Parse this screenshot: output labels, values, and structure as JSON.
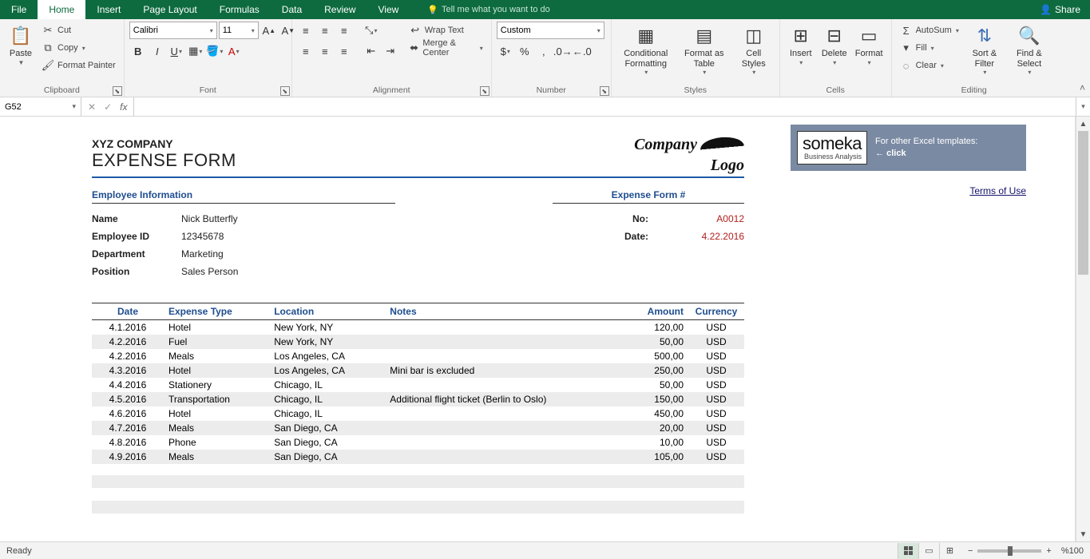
{
  "menu": {
    "tabs": [
      "File",
      "Home",
      "Insert",
      "Page Layout",
      "Formulas",
      "Data",
      "Review",
      "View"
    ],
    "active": "Home",
    "tell_me": "Tell me what you want to do",
    "share": "Share"
  },
  "ribbon": {
    "clipboard": {
      "label": "Clipboard",
      "paste": "Paste",
      "cut": "Cut",
      "copy": "Copy",
      "format_painter": "Format Painter"
    },
    "font": {
      "label": "Font",
      "name": "Calibri",
      "size": "11"
    },
    "alignment": {
      "label": "Alignment",
      "wrap": "Wrap Text",
      "merge": "Merge & Center"
    },
    "number": {
      "label": "Number",
      "format": "Custom"
    },
    "styles": {
      "label": "Styles",
      "cond": "Conditional Formatting",
      "as_table": "Format as Table",
      "cell_styles": "Cell Styles"
    },
    "cells": {
      "label": "Cells",
      "insert": "Insert",
      "delete": "Delete",
      "format": "Format"
    },
    "editing": {
      "label": "Editing",
      "autosum": "AutoSum",
      "fill": "Fill",
      "clear": "Clear",
      "sort": "Sort & Filter",
      "find": "Find & Select"
    }
  },
  "namebox": "G52",
  "formula": "",
  "form": {
    "company": "XYZ COMPANY",
    "title": "EXPENSE FORM",
    "logo": {
      "l1": "Company",
      "l2": "Logo"
    },
    "emp_section_title": "Employee Information",
    "emp": {
      "name_lbl": "Name",
      "name": "Nick Butterfly",
      "id_lbl": "Employee ID",
      "id": "12345678",
      "dept_lbl": "Department",
      "dept": "Marketing",
      "pos_lbl": "Position",
      "pos": "Sales Person"
    },
    "meta_title": "Expense Form #",
    "meta": {
      "no_lbl": "No:",
      "no": "A0012",
      "date_lbl": "Date:",
      "date": "4.22.2016"
    },
    "headers": {
      "date": "Date",
      "type": "Expense Type",
      "loc": "Location",
      "notes": "Notes",
      "amt": "Amount",
      "cur": "Currency"
    },
    "rows": [
      {
        "date": "4.1.2016",
        "type": "Hotel",
        "loc": "New York, NY",
        "notes": "",
        "amt": "120,00",
        "cur": "USD"
      },
      {
        "date": "4.2.2016",
        "type": "Fuel",
        "loc": "New York, NY",
        "notes": "",
        "amt": "50,00",
        "cur": "USD"
      },
      {
        "date": "4.2.2016",
        "type": "Meals",
        "loc": "Los Angeles, CA",
        "notes": "",
        "amt": "500,00",
        "cur": "USD"
      },
      {
        "date": "4.3.2016",
        "type": "Hotel",
        "loc": "Los Angeles, CA",
        "notes": "Mini bar is excluded",
        "amt": "250,00",
        "cur": "USD"
      },
      {
        "date": "4.4.2016",
        "type": "Stationery",
        "loc": "Chicago, IL",
        "notes": "",
        "amt": "50,00",
        "cur": "USD"
      },
      {
        "date": "4.5.2016",
        "type": "Transportation",
        "loc": "Chicago, IL",
        "notes": "Additional flight ticket (Berlin to Oslo)",
        "amt": "150,00",
        "cur": "USD"
      },
      {
        "date": "4.6.2016",
        "type": "Hotel",
        "loc": "Chicago, IL",
        "notes": "",
        "amt": "450,00",
        "cur": "USD"
      },
      {
        "date": "4.7.2016",
        "type": "Meals",
        "loc": "San Diego, CA",
        "notes": "",
        "amt": "20,00",
        "cur": "USD"
      },
      {
        "date": "4.8.2016",
        "type": "Phone",
        "loc": "San Diego, CA",
        "notes": "",
        "amt": "10,00",
        "cur": "USD"
      },
      {
        "date": "4.9.2016",
        "type": "Meals",
        "loc": "San Diego, CA",
        "notes": "",
        "amt": "105,00",
        "cur": "USD"
      }
    ]
  },
  "promo": {
    "brand": "someka",
    "sub": "Business Analysis",
    "line1": "For other Excel templates:",
    "click": "← click"
  },
  "terms": "Terms of Use",
  "status": {
    "ready": "Ready",
    "zoom": "%100"
  }
}
